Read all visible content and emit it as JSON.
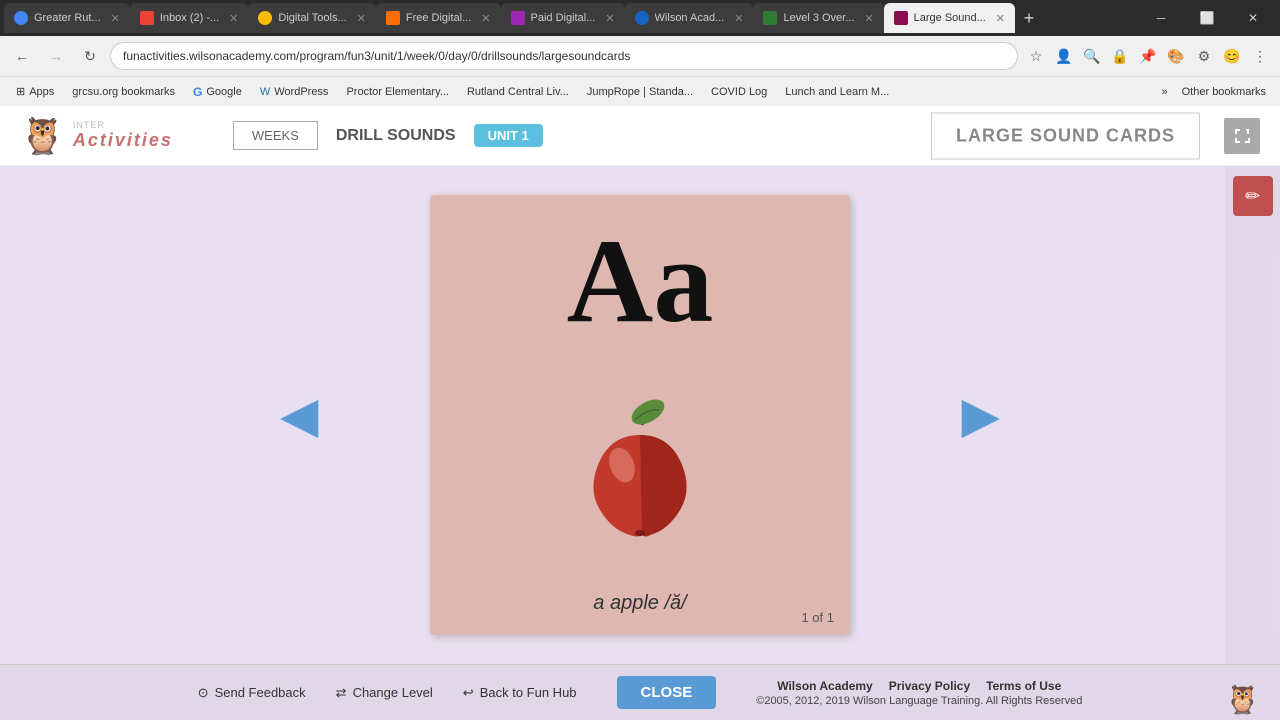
{
  "browser": {
    "tabs": [
      {
        "id": "greater-rut",
        "label": "Greater Rut...",
        "favicon_color": "#4285f4",
        "active": false
      },
      {
        "id": "inbox",
        "label": "Inbox (2) -...",
        "favicon_color": "#ea4335",
        "active": false
      },
      {
        "id": "digital-tools",
        "label": "Digital Tools...",
        "favicon_color": "#fbbc04",
        "active": false
      },
      {
        "id": "free-digital",
        "label": "Free Digital...",
        "favicon_color": "#ff6d00",
        "active": false
      },
      {
        "id": "paid-digital",
        "label": "Paid Digital...",
        "favicon_color": "#9c27b0",
        "active": false
      },
      {
        "id": "wilson-acad",
        "label": "Wilson Acad...",
        "favicon_color": "#1565c0",
        "active": false
      },
      {
        "id": "level3-over",
        "label": "Level 3 Over...",
        "favicon_color": "#2e7d32",
        "active": false
      },
      {
        "id": "large-sound",
        "label": "Large Sound...",
        "favicon_color": "#880e4f",
        "active": true
      }
    ],
    "address": "funactivities.wilsonacademy.com/program/fun3/unit/1/week/0/day/0/drillsounds/largesoundcards",
    "bookmarks": [
      {
        "label": "Apps"
      },
      {
        "label": "grcsu.org bookmarks"
      },
      {
        "label": "Google"
      },
      {
        "label": "WordPress"
      },
      {
        "label": "Proctor Elementary..."
      },
      {
        "label": "Rutland Central Liv..."
      },
      {
        "label": "JumpRope | Standa..."
      },
      {
        "label": "COVID Log"
      },
      {
        "label": "Lunch and Learn M..."
      }
    ],
    "more_bookmarks": "Other bookmarks"
  },
  "page": {
    "logo_inter": "inter",
    "logo_act": "Act",
    "logo_ivities": "ivities",
    "header": {
      "weeks_label": "WEEKS",
      "drill_sounds_label": "DRILL SOUNDS",
      "unit_badge": "UNIT 1",
      "large_sound_cards_label": "LARGE SOUND CARDS"
    },
    "card": {
      "letter": "Aa",
      "label": "a apple /ă/",
      "counter": "1 of 1"
    },
    "footer": {
      "send_feedback": "Send Feedback",
      "change_level": "Change Level",
      "back_to_fun_hub": "Back to Fun Hub",
      "close": "CLOSE",
      "wilson_academy": "Wilson Academy",
      "privacy_policy": "Privacy Policy",
      "terms_of_use": "Terms of Use",
      "copyright": "©2005, 2012, 2019 Wilson Language Training. All Rights Reserved"
    }
  }
}
